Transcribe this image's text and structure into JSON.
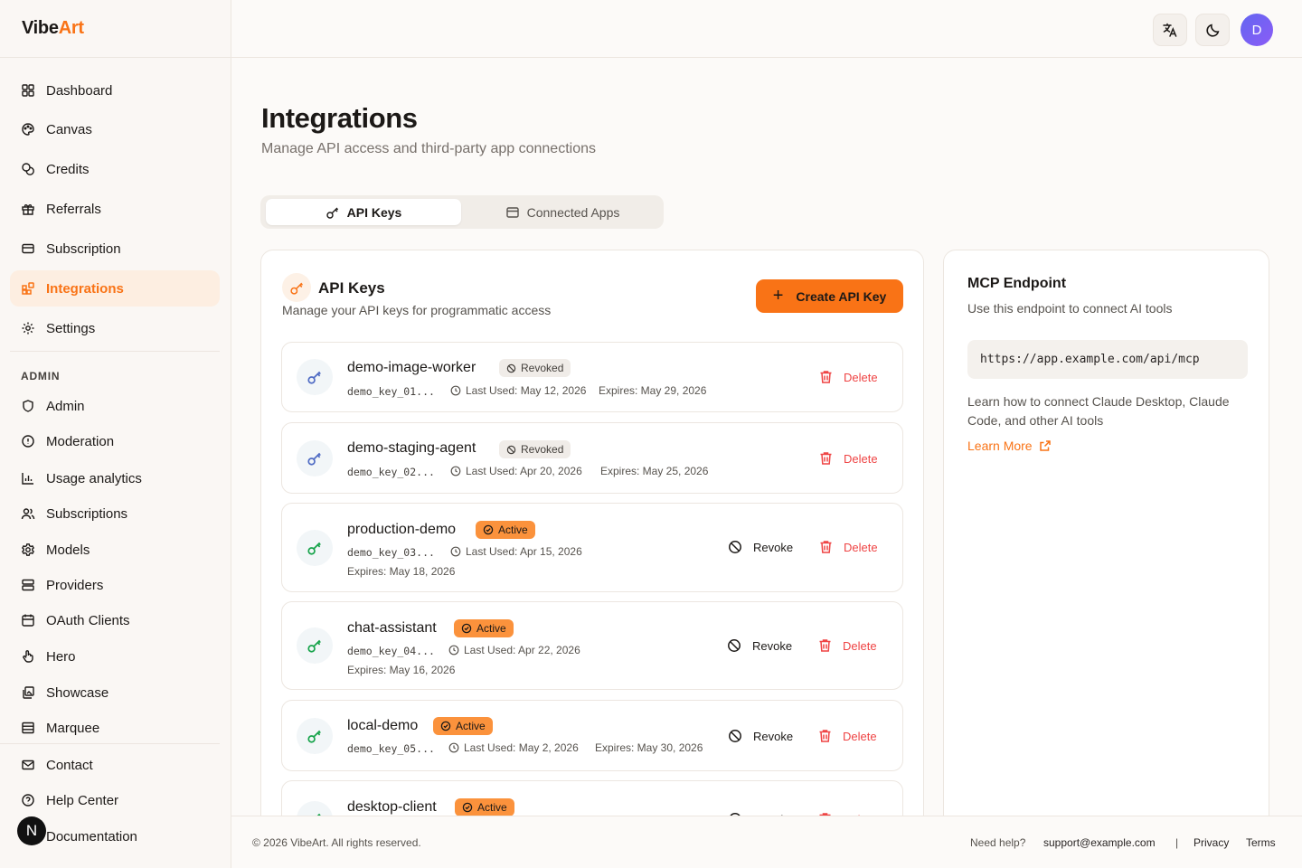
{
  "app": {
    "logo_part1": "Vibe",
    "logo_part2": "Art"
  },
  "header": {
    "avatar_initial": "D",
    "translate_icon": "translate-icon",
    "theme_icon": "moon-icon"
  },
  "sidebar": {
    "items": [
      {
        "label": "Dashboard",
        "icon": "grid-icon"
      },
      {
        "label": "Canvas",
        "icon": "palette-icon"
      },
      {
        "label": "Credits",
        "icon": "coins-icon"
      },
      {
        "label": "Referrals",
        "icon": "gift-icon"
      },
      {
        "label": "Subscription",
        "icon": "credit-card-icon"
      },
      {
        "label": "Integrations",
        "icon": "blocks-icon",
        "active": true
      },
      {
        "label": "Settings",
        "icon": "gear-icon"
      }
    ],
    "admin_section": "ADMIN",
    "admin_items": [
      {
        "label": "Admin",
        "icon": "shield-icon"
      },
      {
        "label": "Moderation",
        "icon": "alert-circle-icon"
      },
      {
        "label": "Usage analytics",
        "icon": "bar-chart-icon"
      },
      {
        "label": "Subscriptions",
        "icon": "users-icon"
      },
      {
        "label": "Models",
        "icon": "cog-icon"
      },
      {
        "label": "Providers",
        "icon": "server-icon"
      },
      {
        "label": "OAuth Clients",
        "icon": "calendar-icon"
      },
      {
        "label": "Hero",
        "icon": "pointer-icon"
      },
      {
        "label": "Showcase",
        "icon": "gallery-icon"
      },
      {
        "label": "Marquee",
        "icon": "rows-icon"
      }
    ],
    "footer_items": [
      {
        "label": "Contact",
        "icon": "mail-icon"
      },
      {
        "label": "Help Center",
        "icon": "help-circle-icon"
      },
      {
        "label": "Documentation",
        "icon": "book-icon"
      }
    ],
    "user_badge": "N"
  },
  "page": {
    "title": "Integrations",
    "subtitle": "Manage API access and third-party app connections"
  },
  "tabs": [
    {
      "label": "API Keys",
      "active": true
    },
    {
      "label": "Connected Apps",
      "active": false
    }
  ],
  "api_keys": {
    "title": "API Keys",
    "subtitle": "Manage your API keys for programmatic access",
    "create_label": "Create API Key",
    "revoke_label": "Revoke",
    "delete_label": "Delete",
    "keys": [
      {
        "name": "demo-image-worker",
        "status": "Revoked",
        "prefix": "demo_key_01...",
        "last_used": "Last Used: May 12, 2026",
        "expires": "Expires: May 29, 2026"
      },
      {
        "name": "demo-staging-agent",
        "status": "Revoked",
        "prefix": "demo_key_02...",
        "last_used": "Last Used: Apr 20, 2026",
        "expires": "Expires: May 25, 2026"
      },
      {
        "name": "production-demo",
        "status": "Active",
        "prefix": "demo_key_03...",
        "last_used": "Last Used: Apr 15, 2026",
        "expires": "Expires: May 18, 2026"
      },
      {
        "name": "chat-assistant",
        "status": "Active",
        "prefix": "demo_key_04...",
        "last_used": "Last Used: Apr 22, 2026",
        "expires": "Expires: May 16, 2026"
      },
      {
        "name": "local-demo",
        "status": "Active",
        "prefix": "demo_key_05...",
        "last_used": "Last Used: May 2, 2026",
        "expires": "Expires: May 30, 2026"
      },
      {
        "name": "desktop-client",
        "status": "Active",
        "prefix": "",
        "last_used": "",
        "expires": ""
      }
    ]
  },
  "mcp": {
    "title": "MCP Endpoint",
    "subtitle": "Use this endpoint to connect AI tools",
    "url": "https://app.example.com/api/mcp",
    "help": "Learn how to connect Claude Desktop, Claude Code, and other AI tools",
    "learn_more": "Learn More"
  },
  "footer": {
    "copyright": "© 2026 VibeArt. All rights reserved.",
    "need_help": "Need help?",
    "email": "support@example.com",
    "sep": "|",
    "privacy": "Privacy",
    "terms": "Terms"
  },
  "colors": {
    "accent": "#f97316",
    "active_badge": "#fb923c",
    "danger": "#ef4444",
    "key_active": "#16a34a",
    "key_revoked": "#4f6bc4"
  }
}
